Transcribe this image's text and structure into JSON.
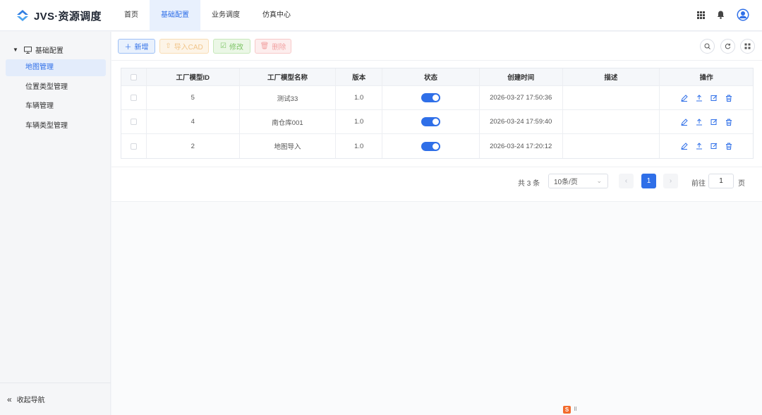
{
  "header": {
    "logo_text": "JVS·资源调度",
    "tabs": [
      {
        "label": "首页",
        "active": false
      },
      {
        "label": "基础配置",
        "active": true
      },
      {
        "label": "业务调度",
        "active": false
      },
      {
        "label": "仿真中心",
        "active": false
      }
    ]
  },
  "sidebar": {
    "group_label": "基础配置",
    "items": [
      {
        "label": "地图管理",
        "active": true
      },
      {
        "label": "位置类型管理",
        "active": false
      },
      {
        "label": "车辆管理",
        "active": false
      },
      {
        "label": "车辆类型管理",
        "active": false
      }
    ],
    "collapse_label": "收起导航"
  },
  "toolbar": {
    "add_label": "新增",
    "import_label": "导入CAD",
    "edit_label": "修改",
    "delete_label": "删除"
  },
  "table": {
    "columns": [
      "工厂模型ID",
      "工厂模型名称",
      "版本",
      "状态",
      "创建时间",
      "描述",
      "操作"
    ],
    "rows": [
      {
        "id": "5",
        "name": "测试33",
        "version": "1.0",
        "enabled": true,
        "created": "2026-03-27 17:50:36",
        "desc": ""
      },
      {
        "id": "4",
        "name": "南仓库001",
        "version": "1.0",
        "enabled": true,
        "created": "2026-03-24 17:59:40",
        "desc": ""
      },
      {
        "id": "2",
        "name": "地图导入",
        "version": "1.0",
        "enabled": true,
        "created": "2026-03-24 17:20:12",
        "desc": ""
      }
    ]
  },
  "pagination": {
    "total_text": "共 3 条",
    "page_size": "10条/页",
    "current_page": "1",
    "goto_label": "前往",
    "goto_value": "1",
    "goto_unit": "页"
  },
  "colors": {
    "primary": "#2f6fe8"
  }
}
